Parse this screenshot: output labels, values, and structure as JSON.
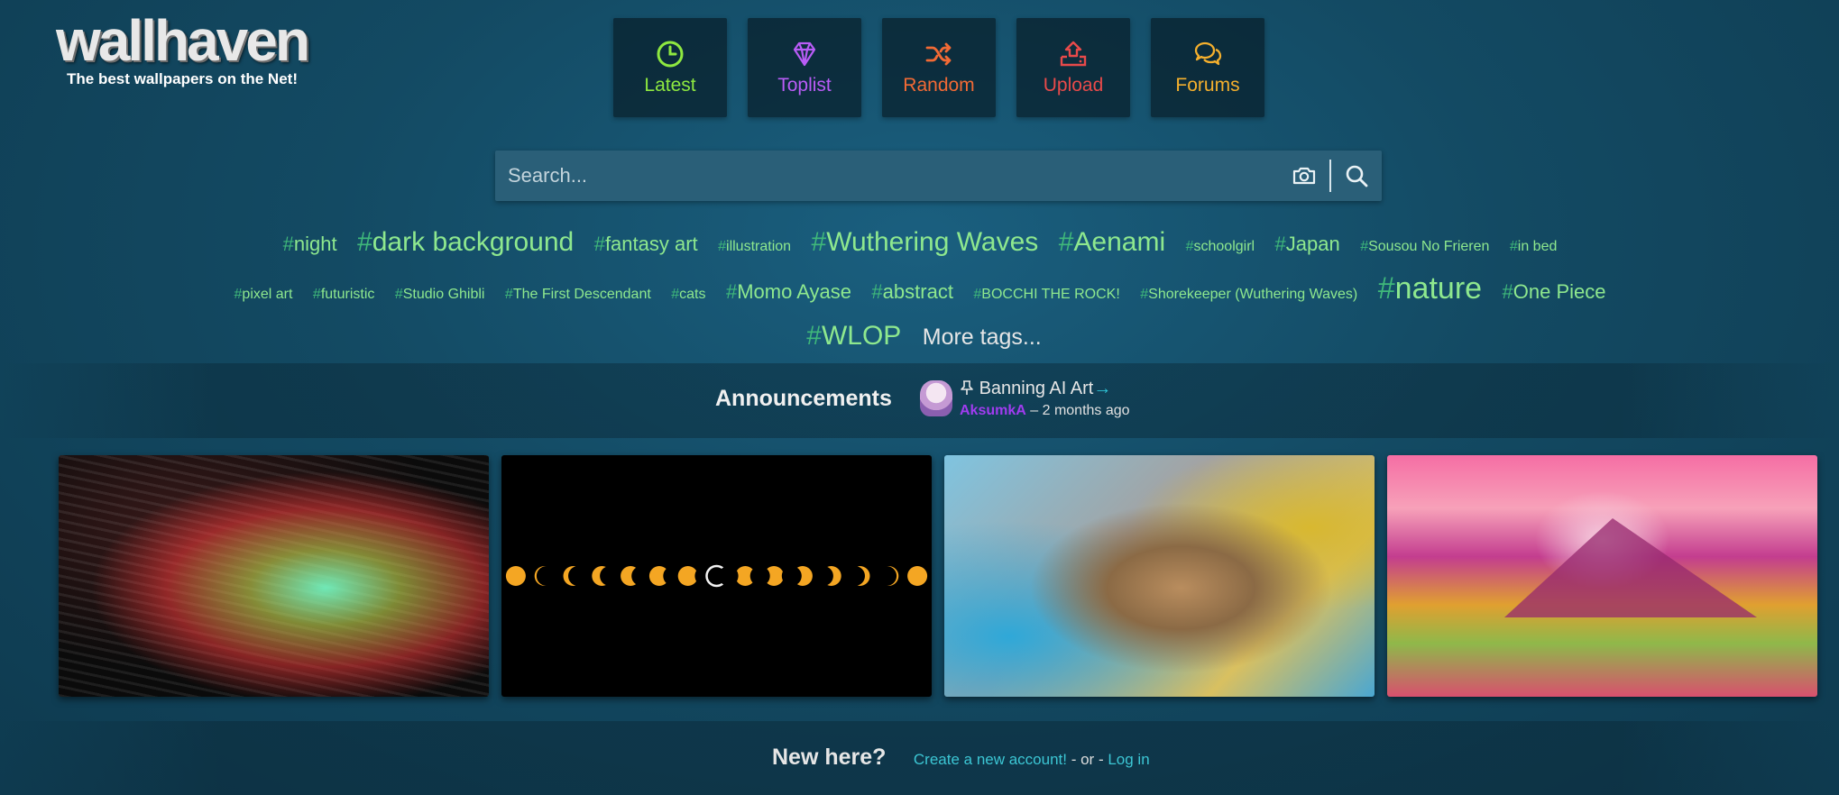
{
  "brand": {
    "name": "wallhaven",
    "tagline": "The best wallpapers on the Net!"
  },
  "nav": [
    {
      "label": "Latest",
      "icon": "clock-icon",
      "color": "#8ee840"
    },
    {
      "label": "Toplist",
      "icon": "diamond-icon",
      "color": "#b95cf6"
    },
    {
      "label": "Random",
      "icon": "shuffle-icon",
      "color": "#f26a35"
    },
    {
      "label": "Upload",
      "icon": "upload-icon",
      "color": "#e84a4a"
    },
    {
      "label": "Forums",
      "icon": "comments-icon",
      "color": "#f5b02d"
    }
  ],
  "search": {
    "placeholder": "Search..."
  },
  "tags": [
    {
      "label": "night",
      "size": "m"
    },
    {
      "label": "dark background",
      "size": "l"
    },
    {
      "label": "fantasy art",
      "size": "m"
    },
    {
      "label": "illustration",
      "size": "s"
    },
    {
      "label": "Wuthering Waves",
      "size": "l"
    },
    {
      "label": "Aenami",
      "size": "l"
    },
    {
      "label": "schoolgirl",
      "size": "s"
    },
    {
      "label": "Japan",
      "size": "m"
    },
    {
      "label": "Sousou No Frieren",
      "size": "s"
    },
    {
      "label": "in bed",
      "size": "s"
    },
    {
      "label": "pixel art",
      "size": "s"
    },
    {
      "label": "futuristic",
      "size": "s"
    },
    {
      "label": "Studio Ghibli",
      "size": "s"
    },
    {
      "label": "The First Descendant",
      "size": "s"
    },
    {
      "label": "cats",
      "size": "s"
    },
    {
      "label": "Momo Ayase",
      "size": "m"
    },
    {
      "label": "abstract",
      "size": "m"
    },
    {
      "label": "BOCCHI THE ROCK!",
      "size": "s"
    },
    {
      "label": "Shorekeeper (Wuthering Waves)",
      "size": "s"
    },
    {
      "label": "nature",
      "size": "xl"
    },
    {
      "label": "One Piece",
      "size": "m"
    },
    {
      "label": "WLOP",
      "size": "l"
    }
  ],
  "more_tags_label": "More tags...",
  "announcements": {
    "title": "Announcements",
    "post_title": "Banning AI Art",
    "author": "AksumkA",
    "separator": " – ",
    "age": "2 months ago"
  },
  "thumbnails": [
    {
      "name": "tunnel-wallpaper"
    },
    {
      "name": "eclipse-wallpaper"
    },
    {
      "name": "island-wallpaper"
    },
    {
      "name": "mountain-wallpaper"
    }
  ],
  "newhere": {
    "title": "New here?",
    "create_label": "Create a new account!",
    "or_label": " - or - ",
    "login_label": "Log in"
  }
}
